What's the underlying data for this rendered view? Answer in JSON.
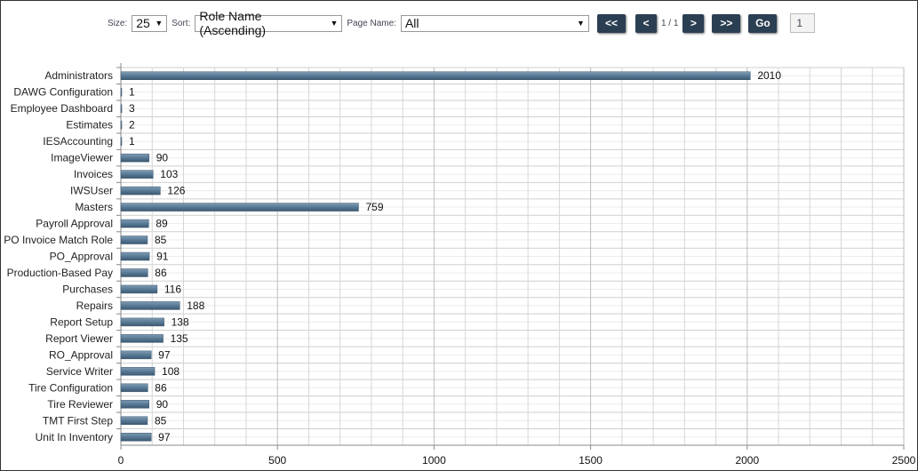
{
  "toolbar": {
    "size_label": "Size:",
    "size_value": "25",
    "sort_label": "Sort:",
    "sort_value": "Role Name (Ascending)",
    "page_name_label": "Page Name:",
    "page_name_value": "All",
    "first_label": "<<",
    "prev_label": "<",
    "page_indicator": "1 / 1",
    "next_label": ">",
    "last_label": ">>",
    "go_label": "Go",
    "page_input": "1"
  },
  "chart_data": {
    "type": "bar",
    "orientation": "horizontal",
    "categories": [
      "Administrators",
      "DAWG Configuration",
      "Employee Dashboard",
      "Estimates",
      "IESAccounting",
      "ImageViewer",
      "Invoices",
      "IWSUser",
      "Masters",
      "Payroll Approval",
      "PO Invoice Match Role",
      "PO_Approval",
      "Production-Based Pay",
      "Purchases",
      "Repairs",
      "Report Setup",
      "Report Viewer",
      "RO_Approval",
      "Service Writer",
      "Tire Configuration",
      "Tire Reviewer",
      "TMT First Step",
      "Unit In Inventory"
    ],
    "values": [
      2010,
      1,
      3,
      2,
      1,
      90,
      103,
      126,
      759,
      89,
      85,
      91,
      86,
      116,
      188,
      138,
      135,
      97,
      108,
      86,
      90,
      85,
      97
    ],
    "xlim": [
      0,
      2500
    ],
    "xticks": [
      "0",
      "500",
      "1000",
      "1500",
      "2000",
      "2500"
    ],
    "grid": true,
    "bar_color": "#587a96",
    "data_labels": true
  }
}
